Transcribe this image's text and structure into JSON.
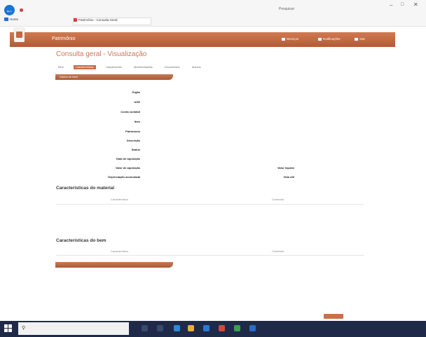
{
  "browser": {
    "address_text": "",
    "search_text": "Pesquisar",
    "tabs": [
      {
        "label": "Home"
      },
      {
        "label": "Patrimônio - Consulta Geral"
      }
    ],
    "window_controls": {
      "minimize": "–",
      "maximize": "□",
      "close": "✕"
    }
  },
  "app": {
    "title": "Patrimônio",
    "user_links": "",
    "nav": [
      {
        "label": "Serviços"
      },
      {
        "label": "Notificações"
      },
      {
        "label": "Sair"
      }
    ]
  },
  "page": {
    "title": "Consulta geral - Visualização",
    "tabs": [
      {
        "label": "Bem",
        "active": false
      },
      {
        "label": "Características",
        "active": true
      },
      {
        "label": "Lançamentos",
        "active": false
      },
      {
        "label": "Movimentações",
        "active": false
      },
      {
        "label": "Documentos",
        "active": false
      },
      {
        "label": "Anexos",
        "active": false
      }
    ]
  },
  "section1": {
    "header": "Dados do bem",
    "link": "",
    "fields": [
      {
        "label": "Órgão",
        "value": ""
      },
      {
        "label": "UGE",
        "value": ""
      },
      {
        "label": "Conta contábil",
        "value": ""
      },
      {
        "label": "Item",
        "value": ""
      },
      {
        "label": "Patrimônio",
        "value": ""
      },
      {
        "label": "Descrição",
        "value": ""
      },
      {
        "label": "Status",
        "value": ""
      },
      {
        "label": "Data de aquisição",
        "value": ""
      },
      {
        "label": "Valor de aquisição",
        "value": ""
      },
      {
        "label": "Depreciação acumulada",
        "value": ""
      }
    ],
    "right_fields": [
      {
        "label": "Valor líquido",
        "value": ""
      },
      {
        "label": "Vida útil",
        "value": ""
      }
    ]
  },
  "materials": {
    "title": "Características do material",
    "col1": "Característica",
    "col2": "Conteúdo",
    "rows": [
      {
        "c1": "",
        "c2": ""
      },
      {
        "c1": "",
        "c2": ""
      },
      {
        "c1": "",
        "c2": ""
      }
    ]
  },
  "bem": {
    "title": "Características do bem",
    "col1": "Característica",
    "col2": "Conteúdo"
  },
  "section3": {
    "header": ""
  },
  "actions": {
    "confirm": ""
  },
  "taskbar": {
    "search_placeholder": "",
    "tray_text": "",
    "time": "",
    "date": ""
  },
  "colors": {
    "accent": "#c8704a",
    "taskbar": "#1f2a48"
  }
}
